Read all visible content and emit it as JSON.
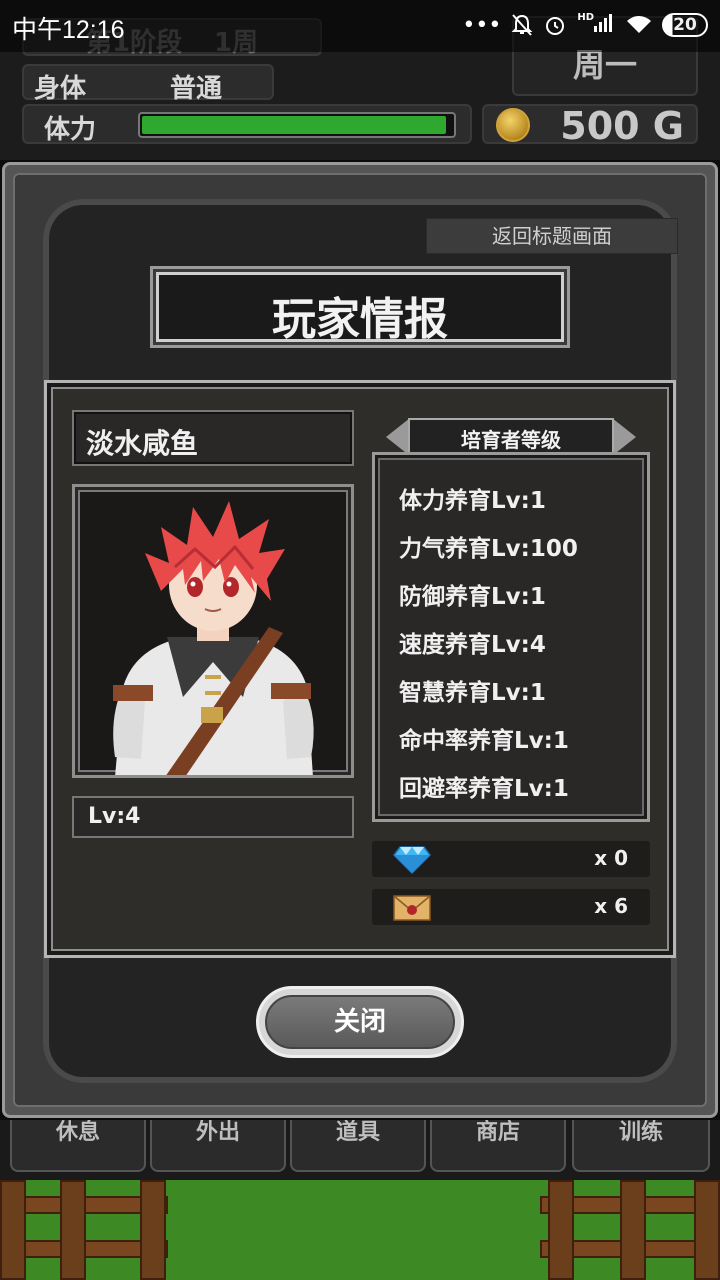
{
  "status_bar": {
    "time": "中午12:16",
    "dots": "•••",
    "hd_label": "HD",
    "battery": "20"
  },
  "hud": {
    "stage_label": "第1阶段",
    "week_label": "1周",
    "body_label": "身体",
    "body_value": "普通",
    "hp_label": "体力",
    "hp_fraction": 0.98,
    "weekday": "周一",
    "gold": "500 G"
  },
  "bottom_nav": [
    "休息",
    "外出",
    "道具",
    "商店",
    "训练"
  ],
  "modal": {
    "back_button": "返回标题画面",
    "title": "玩家情报",
    "player_name": "淡水咸鱼",
    "player_level": "Lv:4",
    "rank_header": "培育者等级",
    "stats": [
      "体力养育Lv:1",
      "力气养育Lv:100",
      "防御养育Lv:1",
      "速度养育Lv:4",
      "智慧养育Lv:1",
      "命中率养育Lv:1",
      "回避率养育Lv:1"
    ],
    "diamond_count": "x 0",
    "letter_count": "x 6",
    "close_button": "关闭"
  },
  "colors": {
    "hp_bar": "#2ea82e",
    "hair": "#e84a4a",
    "coin": "#d0a43a"
  },
  "icons": {
    "resource_1": "diamond-icon",
    "resource_2": "letter-icon",
    "gold": "coin-icon"
  }
}
